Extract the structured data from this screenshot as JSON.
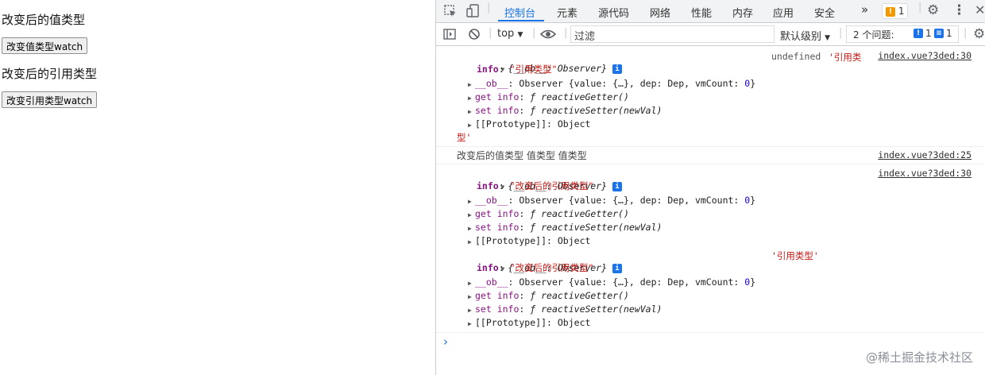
{
  "page": {
    "value_heading": "改变后的值类型",
    "value_button": "改变值类型watch",
    "ref_heading": "改变后的引用类型",
    "ref_button": "改变引用类型watch"
  },
  "devtools": {
    "tabs": [
      "控制台",
      "元素",
      "源代码",
      "网络",
      "性能",
      "内存",
      "应用",
      "安全"
    ],
    "more": "»",
    "warning_count": "1",
    "toolbar": {
      "context": "top",
      "filter_placeholder": "过滤",
      "level": "默认级别",
      "issues_label": "2 个问题:",
      "issues_warn": "1",
      "issues_info": "1"
    },
    "console": {
      "entry1": {
        "header": "{__ob__: Observer}",
        "side_text_a": "undefined ",
        "side_text_b": "'引用类",
        "wrap": "型'",
        "link": "index.vue?3ded:30",
        "info_value": "\"引用类型\""
      },
      "log_line": {
        "text": "改变后的值类型 值类型 值类型",
        "link": "index.vue?3ded:25"
      },
      "entry2": {
        "header": "{__ob__: Observer}",
        "link": "index.vue?3ded:30",
        "info_value": "\"改变后的引用类型\""
      },
      "entry3": {
        "header": "{__ob__: Observer}",
        "side_text": "'引用类型'",
        "info_value": "\"改变后的引用类型\""
      },
      "labels": {
        "info_key": "info",
        "ob_key": "__ob__",
        "ob_value": "Observer {value: {…}, dep: Dep, vmCount: ",
        "vm_count": "0",
        "get_key": "get info",
        "get_value": "reactiveGetter()",
        "set_key": "set info",
        "set_value": "reactiveSetter(newVal)",
        "proto": "[[Prototype]]",
        "proto_value": "Object",
        "f": "ƒ"
      },
      "prompt": "›"
    }
  },
  "watermark": "@稀土掘金技术社区",
  "colors": {
    "accent": "#1a73e8",
    "string": "#c41a16",
    "property": "#881280",
    "warning": "#f29900"
  }
}
